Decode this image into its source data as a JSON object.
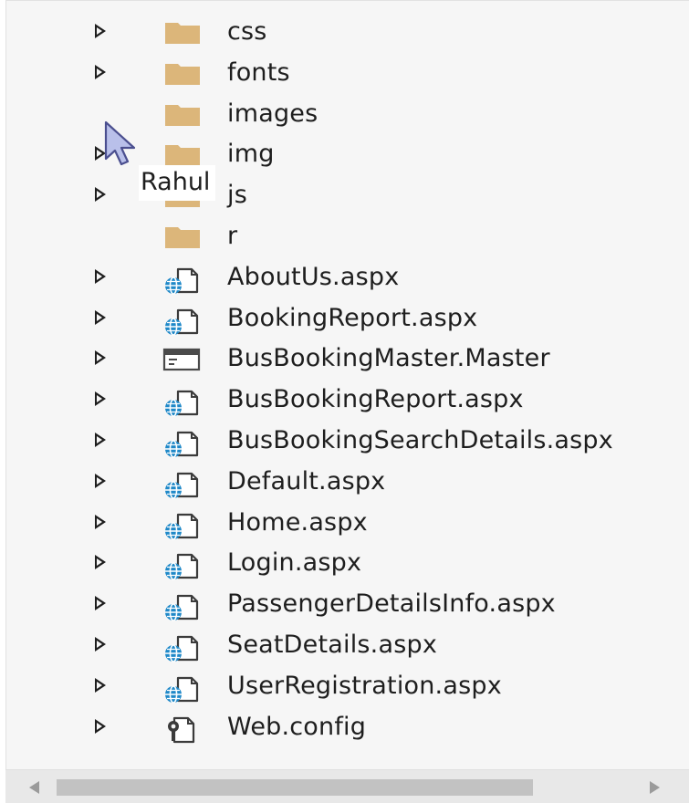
{
  "tree": {
    "items": [
      {
        "label": "css",
        "icon": "folder-icon",
        "expandable": true
      },
      {
        "label": "fonts",
        "icon": "folder-icon",
        "expandable": true
      },
      {
        "label": "images",
        "icon": "folder-icon",
        "expandable": false
      },
      {
        "label": "img",
        "icon": "folder-icon",
        "expandable": true
      },
      {
        "label": "js",
        "icon": "folder-icon",
        "expandable": true
      },
      {
        "label": "r",
        "icon": "folder-icon",
        "expandable": false
      },
      {
        "label": "AboutUs.aspx",
        "icon": "aspx-file-icon",
        "expandable": true
      },
      {
        "label": "BookingReport.aspx",
        "icon": "aspx-file-icon",
        "expandable": true
      },
      {
        "label": "BusBookingMaster.Master",
        "icon": "master-page-icon",
        "expandable": true
      },
      {
        "label": "BusBookingReport.aspx",
        "icon": "aspx-file-icon",
        "expandable": true
      },
      {
        "label": "BusBookingSearchDetails.aspx",
        "icon": "aspx-file-icon",
        "expandable": true
      },
      {
        "label": "Default.aspx",
        "icon": "aspx-file-icon",
        "expandable": true
      },
      {
        "label": "Home.aspx",
        "icon": "aspx-file-icon",
        "expandable": true
      },
      {
        "label": "Login.aspx",
        "icon": "aspx-file-icon",
        "expandable": true
      },
      {
        "label": "PassengerDetailsInfo.aspx",
        "icon": "aspx-file-icon",
        "expandable": true
      },
      {
        "label": "SeatDetails.aspx",
        "icon": "aspx-file-icon",
        "expandable": true
      },
      {
        "label": "UserRegistration.aspx",
        "icon": "aspx-file-icon",
        "expandable": true
      },
      {
        "label": "Web.config",
        "icon": "config-file-icon",
        "expandable": true
      }
    ]
  },
  "tooltip": {
    "text": "Rahul"
  },
  "colors": {
    "folder": "#dcb67a",
    "globe": "#1e88c8",
    "text": "#1e1e1e",
    "panel_bg": "#f6f6f6"
  }
}
